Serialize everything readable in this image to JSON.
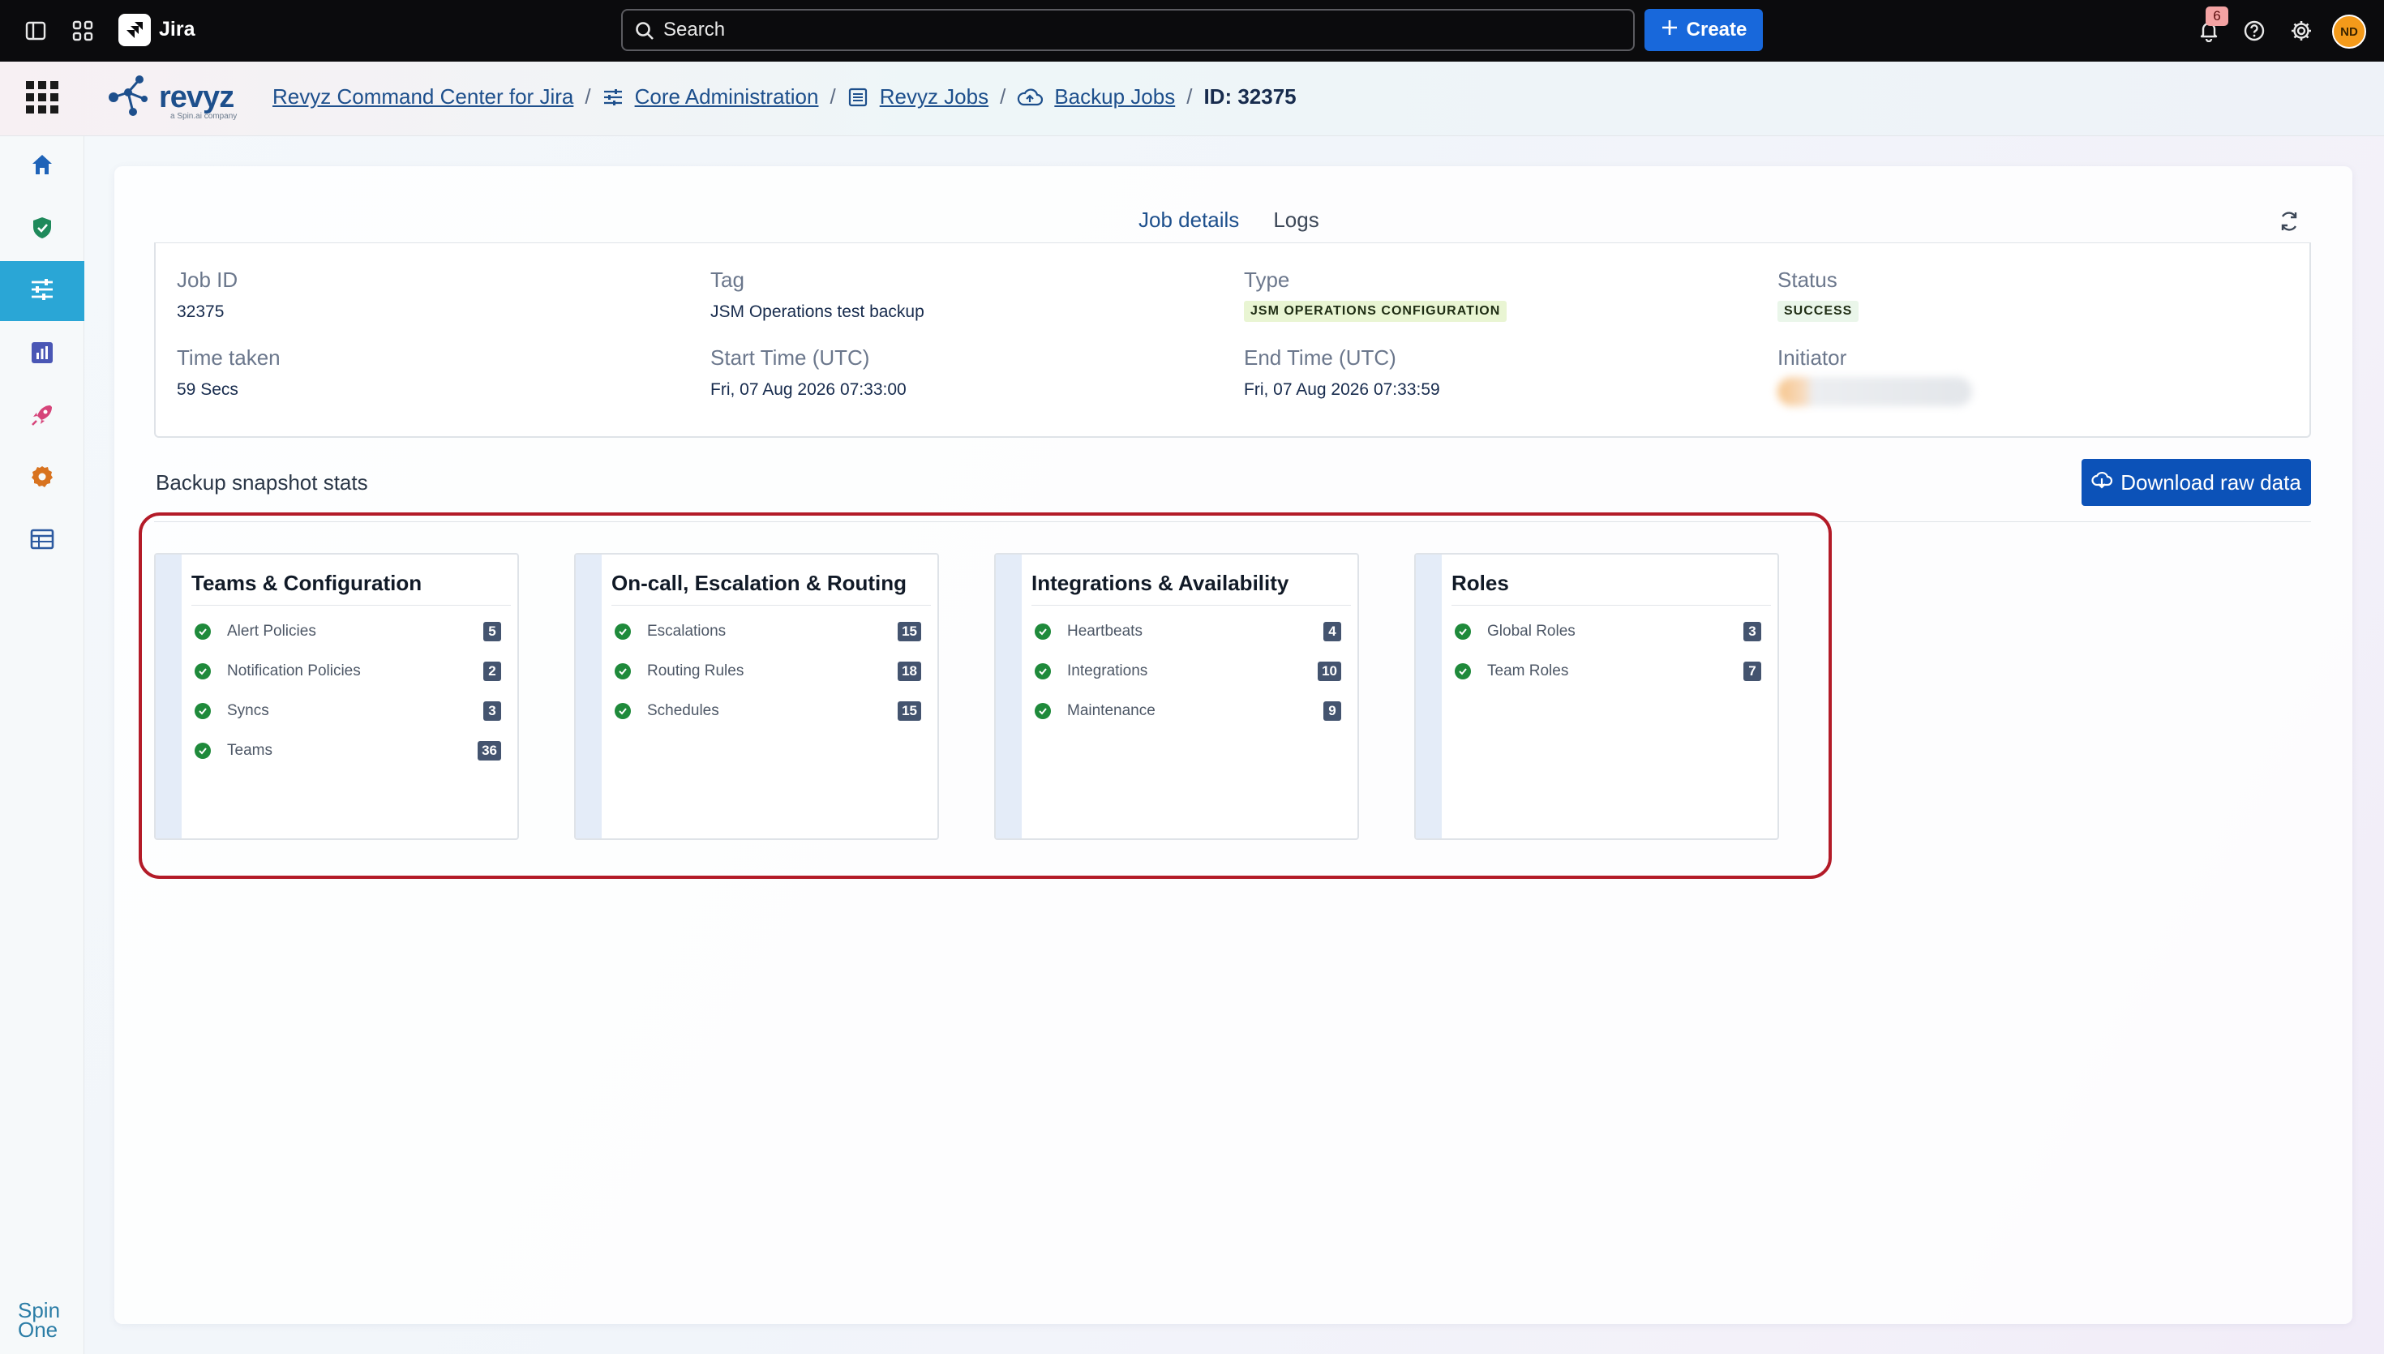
{
  "topbar": {
    "app_name": "Jira",
    "search_placeholder": "Search",
    "create_label": "Create",
    "notification_count": "6",
    "avatar_initials": "ND"
  },
  "breadcrumb": {
    "brand": "revyz",
    "brand_sub": "a Spin.ai company",
    "items": [
      {
        "label": "Revyz Command Center for Jira"
      },
      {
        "label": "Core Administration"
      },
      {
        "label": "Revyz Jobs"
      },
      {
        "label": "Backup Jobs"
      }
    ],
    "current": "ID: 32375"
  },
  "tabs": [
    {
      "label": "Job details",
      "active": true
    },
    {
      "label": "Logs",
      "active": false
    }
  ],
  "job": {
    "job_id_label": "Job ID",
    "job_id": "32375",
    "tag_label": "Tag",
    "tag": "JSM Operations test backup",
    "type_label": "Type",
    "type": "JSM OPERATIONS CONFIGURATION",
    "status_label": "Status",
    "status": "SUCCESS",
    "time_taken_label": "Time taken",
    "time_taken": "59 Secs",
    "start_label": "Start Time (UTC)",
    "start": "Fri, 07 Aug 2026 07:33:00",
    "end_label": "End Time (UTC)",
    "end": "Fri, 07 Aug 2026 07:33:59",
    "initiator_label": "Initiator"
  },
  "stats": {
    "title": "Backup snapshot stats",
    "download_label": "Download raw data",
    "cards": [
      {
        "title": "Teams & Configuration",
        "items": [
          {
            "label": "Alert Policies",
            "count": "5"
          },
          {
            "label": "Notification Policies",
            "count": "2"
          },
          {
            "label": "Syncs",
            "count": "3"
          },
          {
            "label": "Teams",
            "count": "36"
          }
        ]
      },
      {
        "title": "On-call, Escalation & Routing",
        "items": [
          {
            "label": "Escalations",
            "count": "15"
          },
          {
            "label": "Routing Rules",
            "count": "18"
          },
          {
            "label": "Schedules",
            "count": "15"
          }
        ]
      },
      {
        "title": "Integrations & Availability",
        "items": [
          {
            "label": "Heartbeats",
            "count": "4"
          },
          {
            "label": "Integrations",
            "count": "10"
          },
          {
            "label": "Maintenance",
            "count": "9"
          }
        ]
      },
      {
        "title": "Roles",
        "items": [
          {
            "label": "Global Roles",
            "count": "3"
          },
          {
            "label": "Team Roles",
            "count": "7"
          }
        ]
      }
    ]
  },
  "sidebar": {
    "items": [
      {
        "icon": "home-icon"
      },
      {
        "icon": "shield-icon"
      },
      {
        "icon": "sliders-icon",
        "active": true
      },
      {
        "icon": "bar-chart-icon"
      },
      {
        "icon": "rocket-icon"
      },
      {
        "icon": "gear-icon"
      },
      {
        "icon": "table-icon"
      }
    ],
    "footer_logo_line1": "Spin",
    "footer_logo_line2": "One"
  },
  "colors": {
    "accent": "#1868db",
    "active_rail": "#2aa6d6",
    "highlight": "#b31b28",
    "success": "#1f8a3b"
  }
}
